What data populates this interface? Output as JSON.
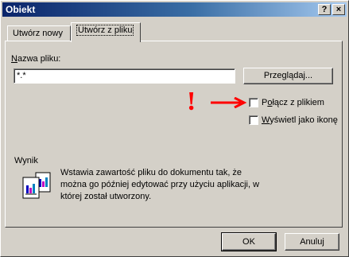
{
  "window": {
    "title": "Obiekt",
    "help_button": "?",
    "close_button": "×"
  },
  "tabs": [
    {
      "label": "Utwórz nowy",
      "active": false
    },
    {
      "label": "Utwórz z pliku",
      "active": true
    }
  ],
  "file": {
    "label_underlined": "N",
    "label_rest": "azwa pliku:",
    "value": "*.*",
    "browse_label_pre": "Prze",
    "browse_label_ul": "g",
    "browse_label_post": "lądaj..."
  },
  "options": {
    "link_pre": "P",
    "link_ul": "o",
    "link_post": "łącz z plikiem",
    "link_checked": false,
    "icon_pre": "",
    "icon_ul": "W",
    "icon_post": "yświetl jako ikonę",
    "icon_checked": false
  },
  "annotation": {
    "mark": "!",
    "color": "#ff0000"
  },
  "result": {
    "title": "Wynik",
    "description": "Wstawia zawartość pliku do dokumentu tak, że można go później edytować przy użyciu aplikacji, w której został utworzony."
  },
  "footer": {
    "ok_label": "OK",
    "cancel_label": "Anuluj"
  },
  "colors": {
    "title_bar": "#0a246a",
    "face": "#d4d0c8",
    "arrow": "#ff0000"
  }
}
